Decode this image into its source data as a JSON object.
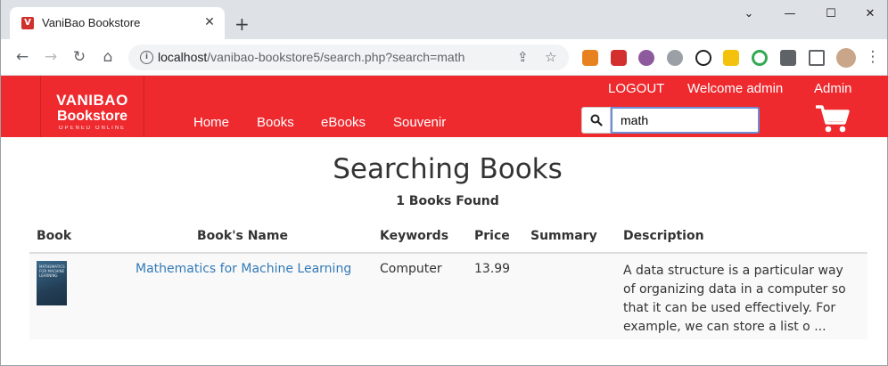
{
  "browser": {
    "tab_title": "VaniBao Bookstore",
    "favicon_letter": "V",
    "tab_close": "✕",
    "new_tab": "+",
    "url_host": "localhost",
    "url_path": "/vanibao-bookstore5/search.php?search=math",
    "window_controls": [
      "⌄",
      "—",
      "☐",
      "✕"
    ]
  },
  "site": {
    "logo": {
      "line1": "VANIBAO",
      "line2": "Bookstore",
      "line3": "OPENED ONLINE"
    },
    "nav": [
      "Home",
      "Books",
      "eBooks",
      "Souvenir"
    ],
    "top_links": {
      "logout": "LOGOUT",
      "welcome": "Welcome admin",
      "admin": "Admin"
    },
    "search_value": "math"
  },
  "main": {
    "heading": "Searching Books",
    "found": "1 Books Found",
    "columns": [
      "Book",
      "Book's Name",
      "Keywords",
      "Price",
      "Summary",
      "Description"
    ],
    "rows": [
      {
        "cover_text": "MATHEMATICS FOR MACHINE LEARNING",
        "name": "Mathematics for Machine Learning",
        "keywords": "Computer",
        "price": "13.99",
        "summary": "",
        "description": "A data structure is a particular way of organizing data in a computer so that it can be used effectively. For example, we can store a list o ..."
      }
    ]
  },
  "colors": {
    "header_red": "#ee2a2f",
    "link_blue": "#337ab7"
  }
}
